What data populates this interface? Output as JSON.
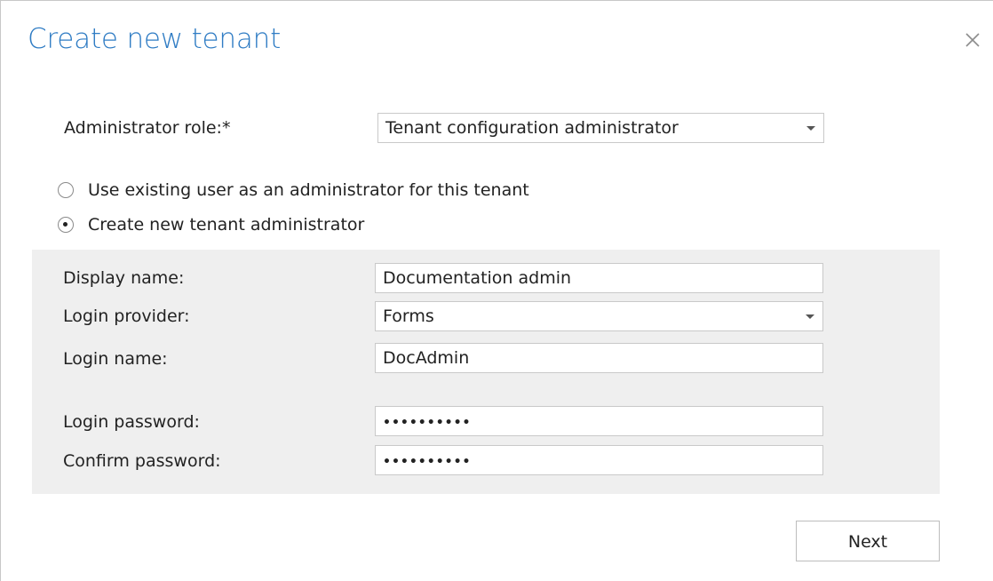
{
  "dialog": {
    "title": "Create new tenant",
    "close_icon": "close-icon"
  },
  "admin_role": {
    "label": "Administrator role:*",
    "value": "Tenant configuration administrator"
  },
  "radios": [
    {
      "label": "Use existing user as an administrator for this tenant",
      "checked": false
    },
    {
      "label": "Create new tenant administrator",
      "checked": true
    }
  ],
  "form": {
    "display_name": {
      "label": "Display name:",
      "value": "Documentation admin"
    },
    "login_provider": {
      "label": "Login provider:",
      "value": "Forms"
    },
    "login_name": {
      "label": "Login name:",
      "value": "DocAdmin"
    },
    "login_password": {
      "label": "Login password:",
      "value": "••••••••••"
    },
    "confirm_password": {
      "label": "Confirm password:",
      "value": "••••••••••"
    }
  },
  "buttons": {
    "next_label": "Next"
  },
  "colors": {
    "title": "#2f7cc4",
    "panel_bg": "#efefef",
    "border": "#c9c9c9"
  }
}
